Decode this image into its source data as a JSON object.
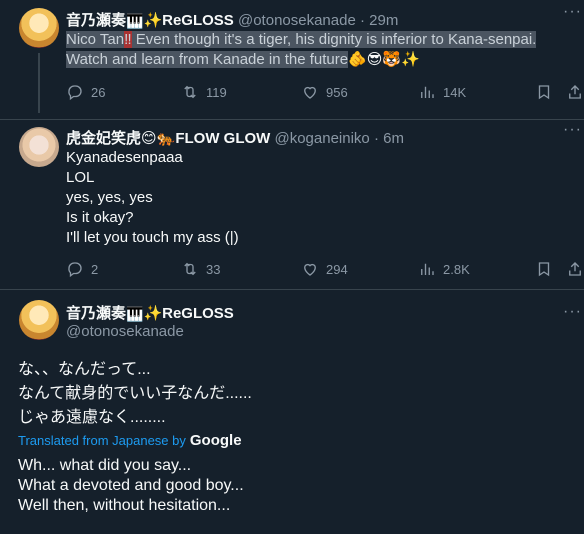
{
  "tweets": [
    {
      "name": "音乃瀬奏",
      "name_suffix": "✨ReGLOSS",
      "handle": "@otonosekanade",
      "dot": "·",
      "time": "29m",
      "text_sel_1": "Nico Tan",
      "text_sel_red": "‼",
      "text_sel_2": " Even though it's a tiger, his dignity is inferior to Kana-senpai.",
      "text_sel_3": "Watch and learn from Kanade in the future",
      "emoji_tail": "🫵😎🐯✨",
      "replies": "26",
      "retweets": "119",
      "likes": "956",
      "views": "14K"
    },
    {
      "name": "虎金妃笑虎",
      "name_suffix": "😊🐅FLOW GLOW",
      "handle": "@koganeiniko",
      "dot": "·",
      "time": "6m",
      "lines": [
        "Kyanadesenpaaa",
        "LOL",
        "yes, yes, yes",
        "Is it okay?",
        "I'll let you touch my ass (|)"
      ],
      "replies": "2",
      "retweets": "33",
      "likes": "294",
      "views": "2.8K"
    },
    {
      "name": "音乃瀬奏",
      "name_suffix": "✨ReGLOSS",
      "handle": "@otonosekanade",
      "jp_lines": [
        "な、、なんだって...",
        "なんて献身的でいい子なんだ......",
        "じゃあ遠慮なく........"
      ],
      "translated_label": "Translated from Japanese by",
      "translator": "Google",
      "en_lines": [
        "Wh... what did you say...",
        "What a devoted and good boy...",
        "Well then, without hesitation..."
      ]
    }
  ],
  "icons": {
    "reply": "reply-icon",
    "retweet": "retweet-icon",
    "like": "like-icon",
    "views": "views-icon",
    "bookmark": "bookmark-icon",
    "share": "share-icon",
    "more": "more-icon",
    "keyboard": "piano-icon"
  }
}
